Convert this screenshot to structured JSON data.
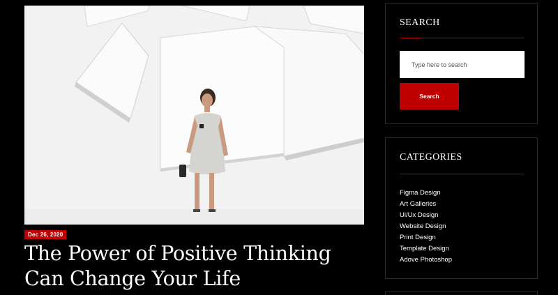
{
  "post": {
    "date": "Dec 26, 2020",
    "title_line1": "The Power of Positive Thinking",
    "title_line2": "Can Change Your Life"
  },
  "search_widget": {
    "title": "SEARCH",
    "placeholder": "Type here to search",
    "button_label": "Search"
  },
  "categories_widget": {
    "title": "CATEGORIES",
    "items": [
      "Figma Design",
      "Art Galleries",
      "Ui/Ux Design",
      "Website Design",
      "Print Design",
      "Template Design",
      "Adove Photoshop"
    ]
  },
  "colors": {
    "background": "#000000",
    "accent": "#c00000",
    "text": "#ffffff"
  }
}
